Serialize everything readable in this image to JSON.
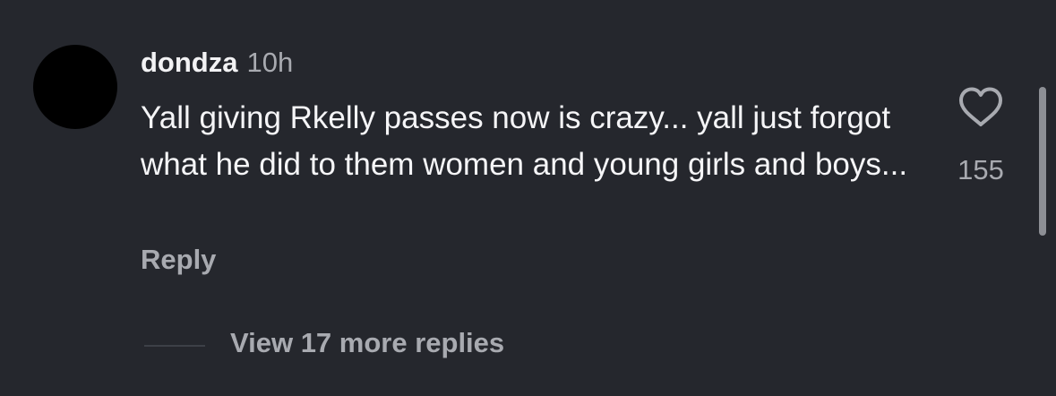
{
  "comment": {
    "username": "dondza",
    "timestamp": "10h",
    "text": "Yall giving Rkelly passes now is crazy... yall just forgot what he did to them women and young girls and boys...",
    "reply_label": "Reply",
    "like_icon": "heart-outline-icon",
    "like_count": "155"
  },
  "replies": {
    "view_more_label": "View 17 more replies"
  },
  "colors": {
    "background": "#25272d",
    "primary_text": "#f5f5f7",
    "secondary_text": "#a8aab0",
    "avatar": "#000000"
  }
}
